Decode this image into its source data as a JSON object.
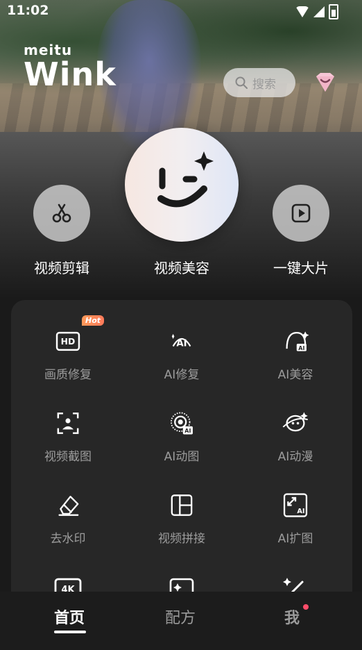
{
  "status": {
    "time": "11:02"
  },
  "brand": {
    "small": "meitu",
    "big": "Wink"
  },
  "search": {
    "placeholder": "搜索"
  },
  "hero": {
    "left_label": "视频剪辑",
    "center_label": "视频美容",
    "right_label": "一键大片"
  },
  "tools": [
    {
      "label": "画质修复",
      "icon": "hd-icon",
      "badge": "Hot"
    },
    {
      "label": "AI修复",
      "icon": "ai-repair-icon"
    },
    {
      "label": "AI美容",
      "icon": "ai-beauty-icon"
    },
    {
      "label": "视频截图",
      "icon": "screenshot-icon"
    },
    {
      "label": "AI动图",
      "icon": "ai-animate-icon"
    },
    {
      "label": "AI动漫",
      "icon": "ai-anime-icon"
    },
    {
      "label": "去水印",
      "icon": "eraser-icon"
    },
    {
      "label": "视频拼接",
      "icon": "collage-icon"
    },
    {
      "label": "AI扩图",
      "icon": "ai-expand-icon"
    }
  ],
  "tabs": {
    "home": "首页",
    "recipe": "配方",
    "me": "我"
  }
}
